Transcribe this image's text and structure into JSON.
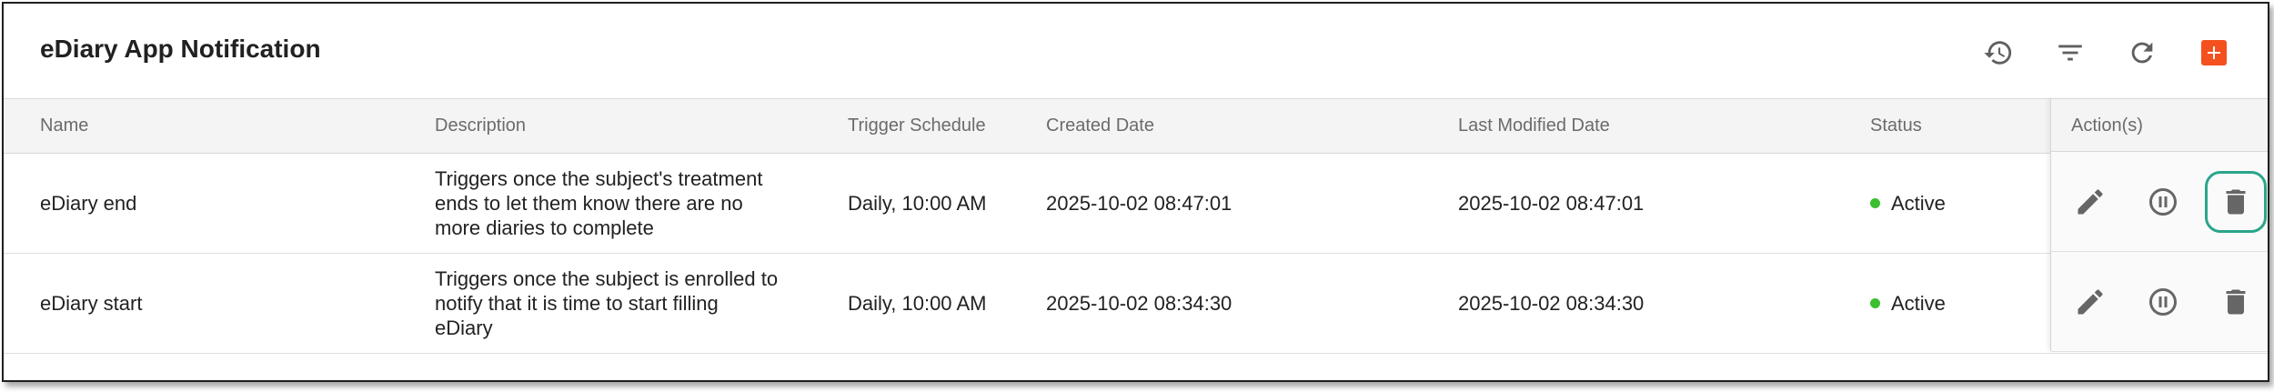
{
  "header": {
    "title": "eDiary App Notification",
    "icons": [
      "history-icon",
      "filter-icon",
      "refresh-icon",
      "add-icon"
    ],
    "accent_color": "#f4511e"
  },
  "table": {
    "columns": {
      "name": "Name",
      "description": "Description",
      "trigger": "Trigger Schedule",
      "created": "Created Date",
      "modified": "Last Modified Date",
      "status": "Status",
      "actions": "Action(s)"
    },
    "rows": [
      {
        "name": "eDiary end",
        "description_lines": [
          "Triggers once the subject's treatment",
          "ends to let them know there are no",
          "more diaries to complete"
        ],
        "trigger": "Daily, 10:00 AM",
        "created": "2025-10-02 08:47:01",
        "modified": "2025-10-02 08:47:01",
        "status": "Active"
      },
      {
        "name": "eDiary start",
        "description_lines": [
          "Triggers once the subject is enrolled to",
          "notify that it is time to start filling",
          "eDiary"
        ],
        "trigger": "Daily, 10:00 AM",
        "created": "2025-10-02 08:34:30",
        "modified": "2025-10-02 08:34:30",
        "status": "Active"
      }
    ],
    "status_color": "#3cbf2f",
    "row_action_icons": [
      "edit-icon",
      "pause-icon",
      "delete-icon"
    ],
    "highlight_color": "#2aa58a"
  }
}
